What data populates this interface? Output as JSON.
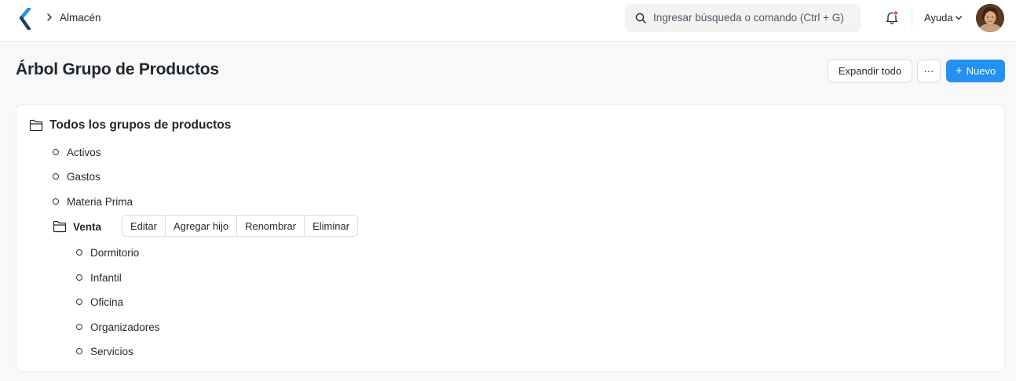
{
  "navbar": {
    "breadcrumb": "Almacén",
    "search_placeholder": "Ingresar búsqueda o comando (Ctrl + G)",
    "help_label": "Ayuda"
  },
  "page": {
    "title": "Árbol Grupo de Productos",
    "expand_all_label": "Expandir todo",
    "more_label": "···",
    "new_label": "Nuevo"
  },
  "tree": {
    "root_label": "Todos los grupos de productos",
    "top_items": [
      "Activos",
      "Gastos",
      "Materia Prima"
    ],
    "group": {
      "label": "Venta",
      "actions": [
        "Editar",
        "Agregar hijo",
        "Renombrar",
        "Eliminar"
      ],
      "children": [
        "Dormitorio",
        "Infantil",
        "Oficina",
        "Organizadores",
        "Servicios"
      ]
    }
  },
  "colors": {
    "primary": "#2490ef",
    "logo": "#1a3f5c",
    "notification_dot": "#e24c4c"
  },
  "icons": [
    "frappe-logo-icon",
    "breadcrumb-chevron-icon",
    "search-icon",
    "bell-icon",
    "chevron-down-icon",
    "folder-open-icon",
    "node-dot-icon"
  ]
}
